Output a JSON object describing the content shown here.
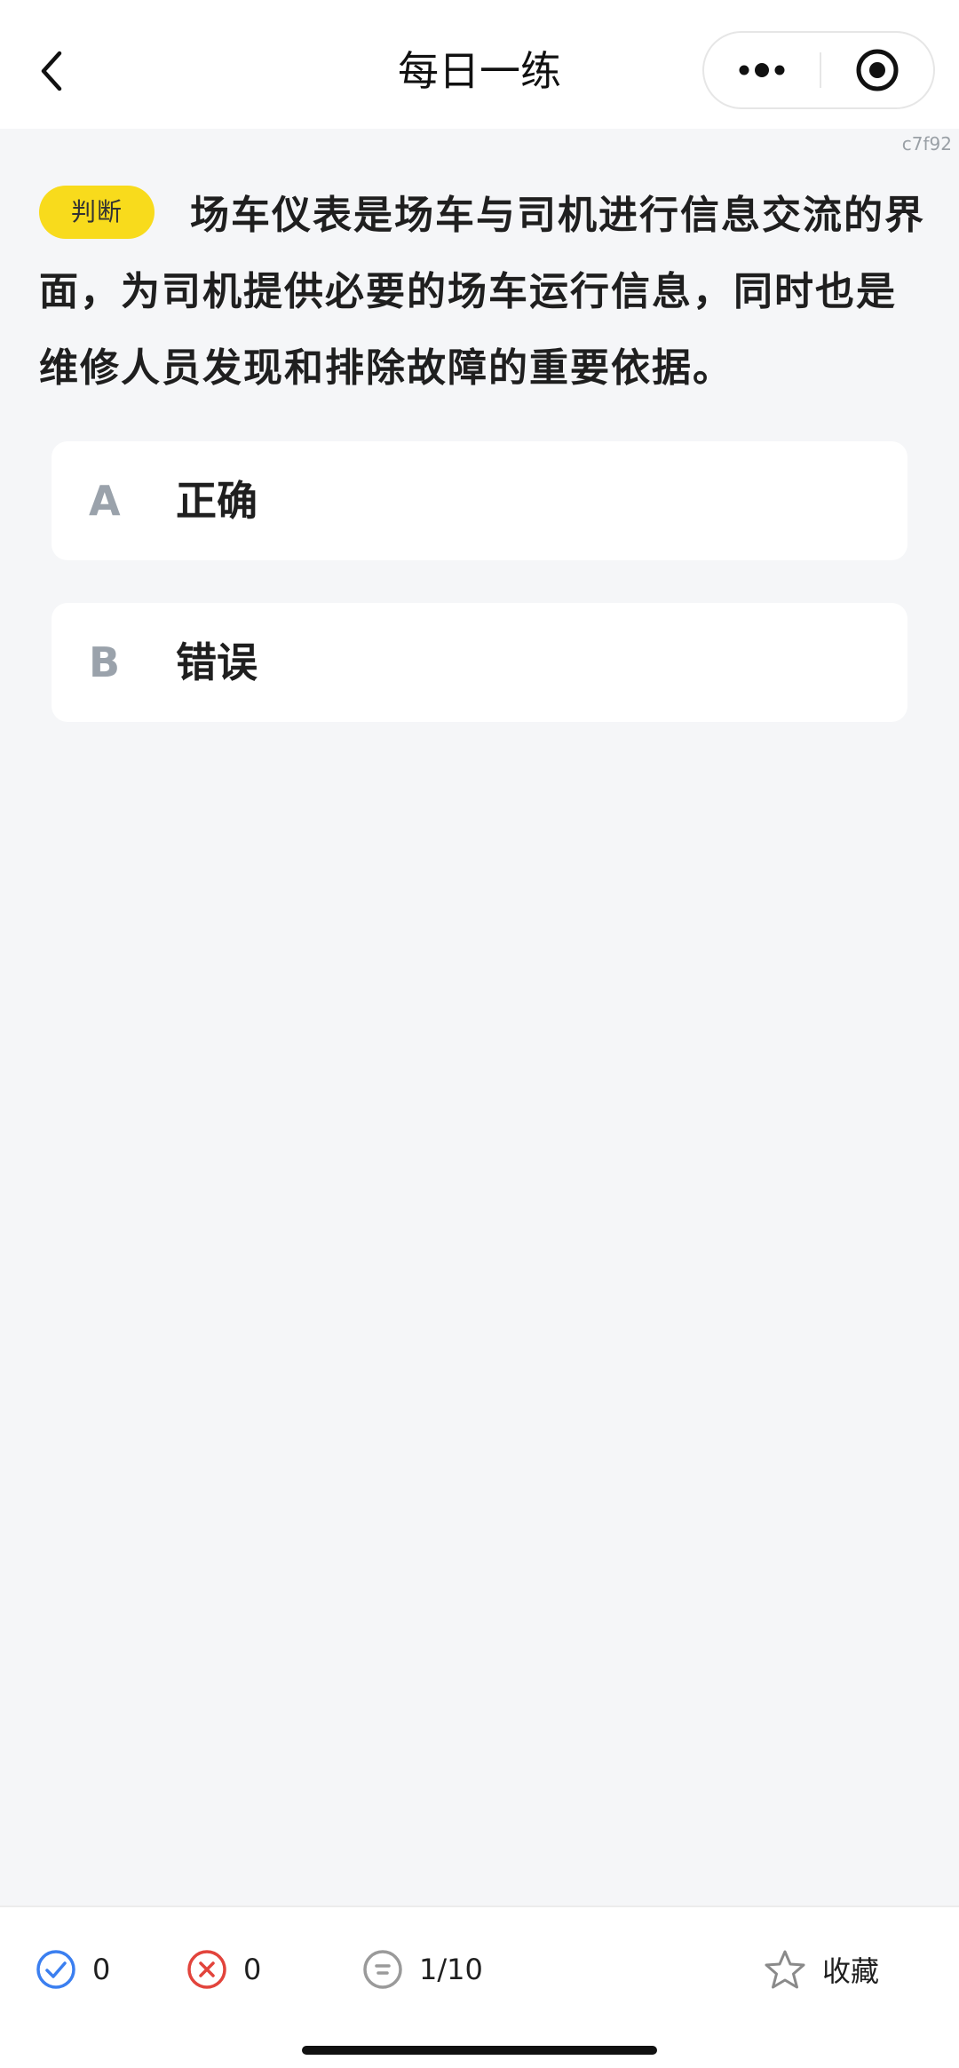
{
  "nav": {
    "title": "每日一练"
  },
  "code_tag": "c7f92",
  "question": {
    "type_label": "判断",
    "text": "场车仪表是场车与司机进行信息交流的界面，为司机提供必要的场车运行信息，同时也是维修人员发现和排除故障的重要依据。"
  },
  "options": [
    {
      "letter": "A",
      "text": "正确"
    },
    {
      "letter": "B",
      "text": "错误"
    }
  ],
  "footer": {
    "correct_count": "0",
    "wrong_count": "0",
    "progress": "1/10",
    "favorite_label": "收藏"
  },
  "colors": {
    "badge": "#f8db1c",
    "correct": "#3b7ff0",
    "wrong": "#e2443c",
    "neutral": "#9a9a9a"
  }
}
